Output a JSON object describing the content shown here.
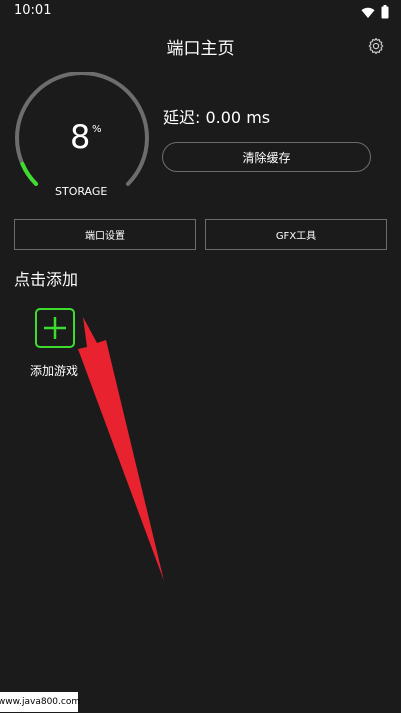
{
  "status_bar": {
    "time": "10:01",
    "icons": [
      "wifi-icon",
      "battery-icon"
    ]
  },
  "header": {
    "title": "端口主页",
    "settings_icon": "gear-icon"
  },
  "storage_gauge": {
    "value": "8",
    "unit": "%",
    "label": "STORAGE",
    "percent": 8,
    "accent_color": "#3ddc2f",
    "track_color": "#6d6d6d"
  },
  "latency": {
    "text": "延迟: 0.00 ms"
  },
  "buttons": {
    "clear_cache": "清除缓存",
    "port_settings": "端口设置",
    "gfx_tool": "GFX工具"
  },
  "add_section": {
    "title": "点击添加",
    "add_game_label": "添加游戏",
    "add_icon": "plus-icon",
    "accent_color": "#3ddc2f"
  },
  "annotation": {
    "arrow_color": "#e8232f"
  },
  "watermark": {
    "text": "www.java800.com"
  }
}
